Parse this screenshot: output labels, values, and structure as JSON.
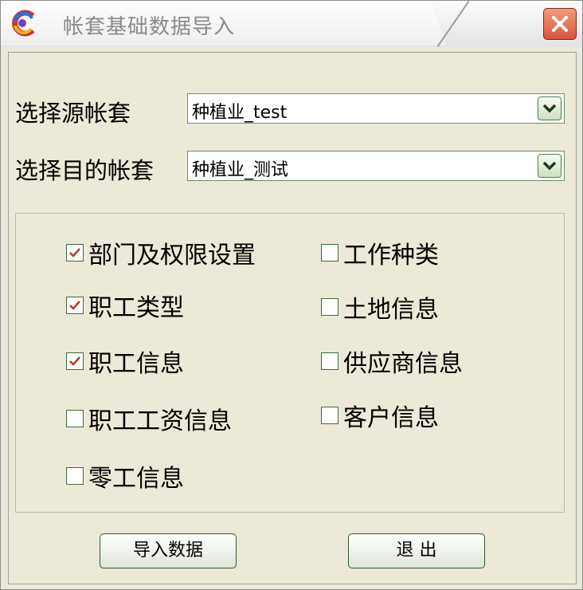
{
  "window": {
    "title": "帐套基础数据导入"
  },
  "source": {
    "label": "选择源帐套",
    "value": "种植业_test"
  },
  "target": {
    "label": "选择目的帐套",
    "value": "种植业_测试"
  },
  "options": [
    {
      "label": "部门及权限设置",
      "checked": true
    },
    {
      "label": "职工类型",
      "checked": true
    },
    {
      "label": "职工信息",
      "checked": true
    },
    {
      "label": "职工工资信息",
      "checked": false
    },
    {
      "label": "零工信息",
      "checked": false
    },
    {
      "label": "工作种类",
      "checked": false
    },
    {
      "label": "土地信息",
      "checked": false
    },
    {
      "label": "供应商信息",
      "checked": false
    },
    {
      "label": "客户信息",
      "checked": false
    }
  ],
  "buttons": {
    "import": "导入数据",
    "exit": "退 出"
  },
  "colors": {
    "checkmark": "#c0392b",
    "close_button": "#d8553a"
  },
  "icons": {
    "logo": "app-logo-icon",
    "close": "close-icon",
    "dropdown": "chevron-down-icon",
    "check": "check-icon"
  }
}
